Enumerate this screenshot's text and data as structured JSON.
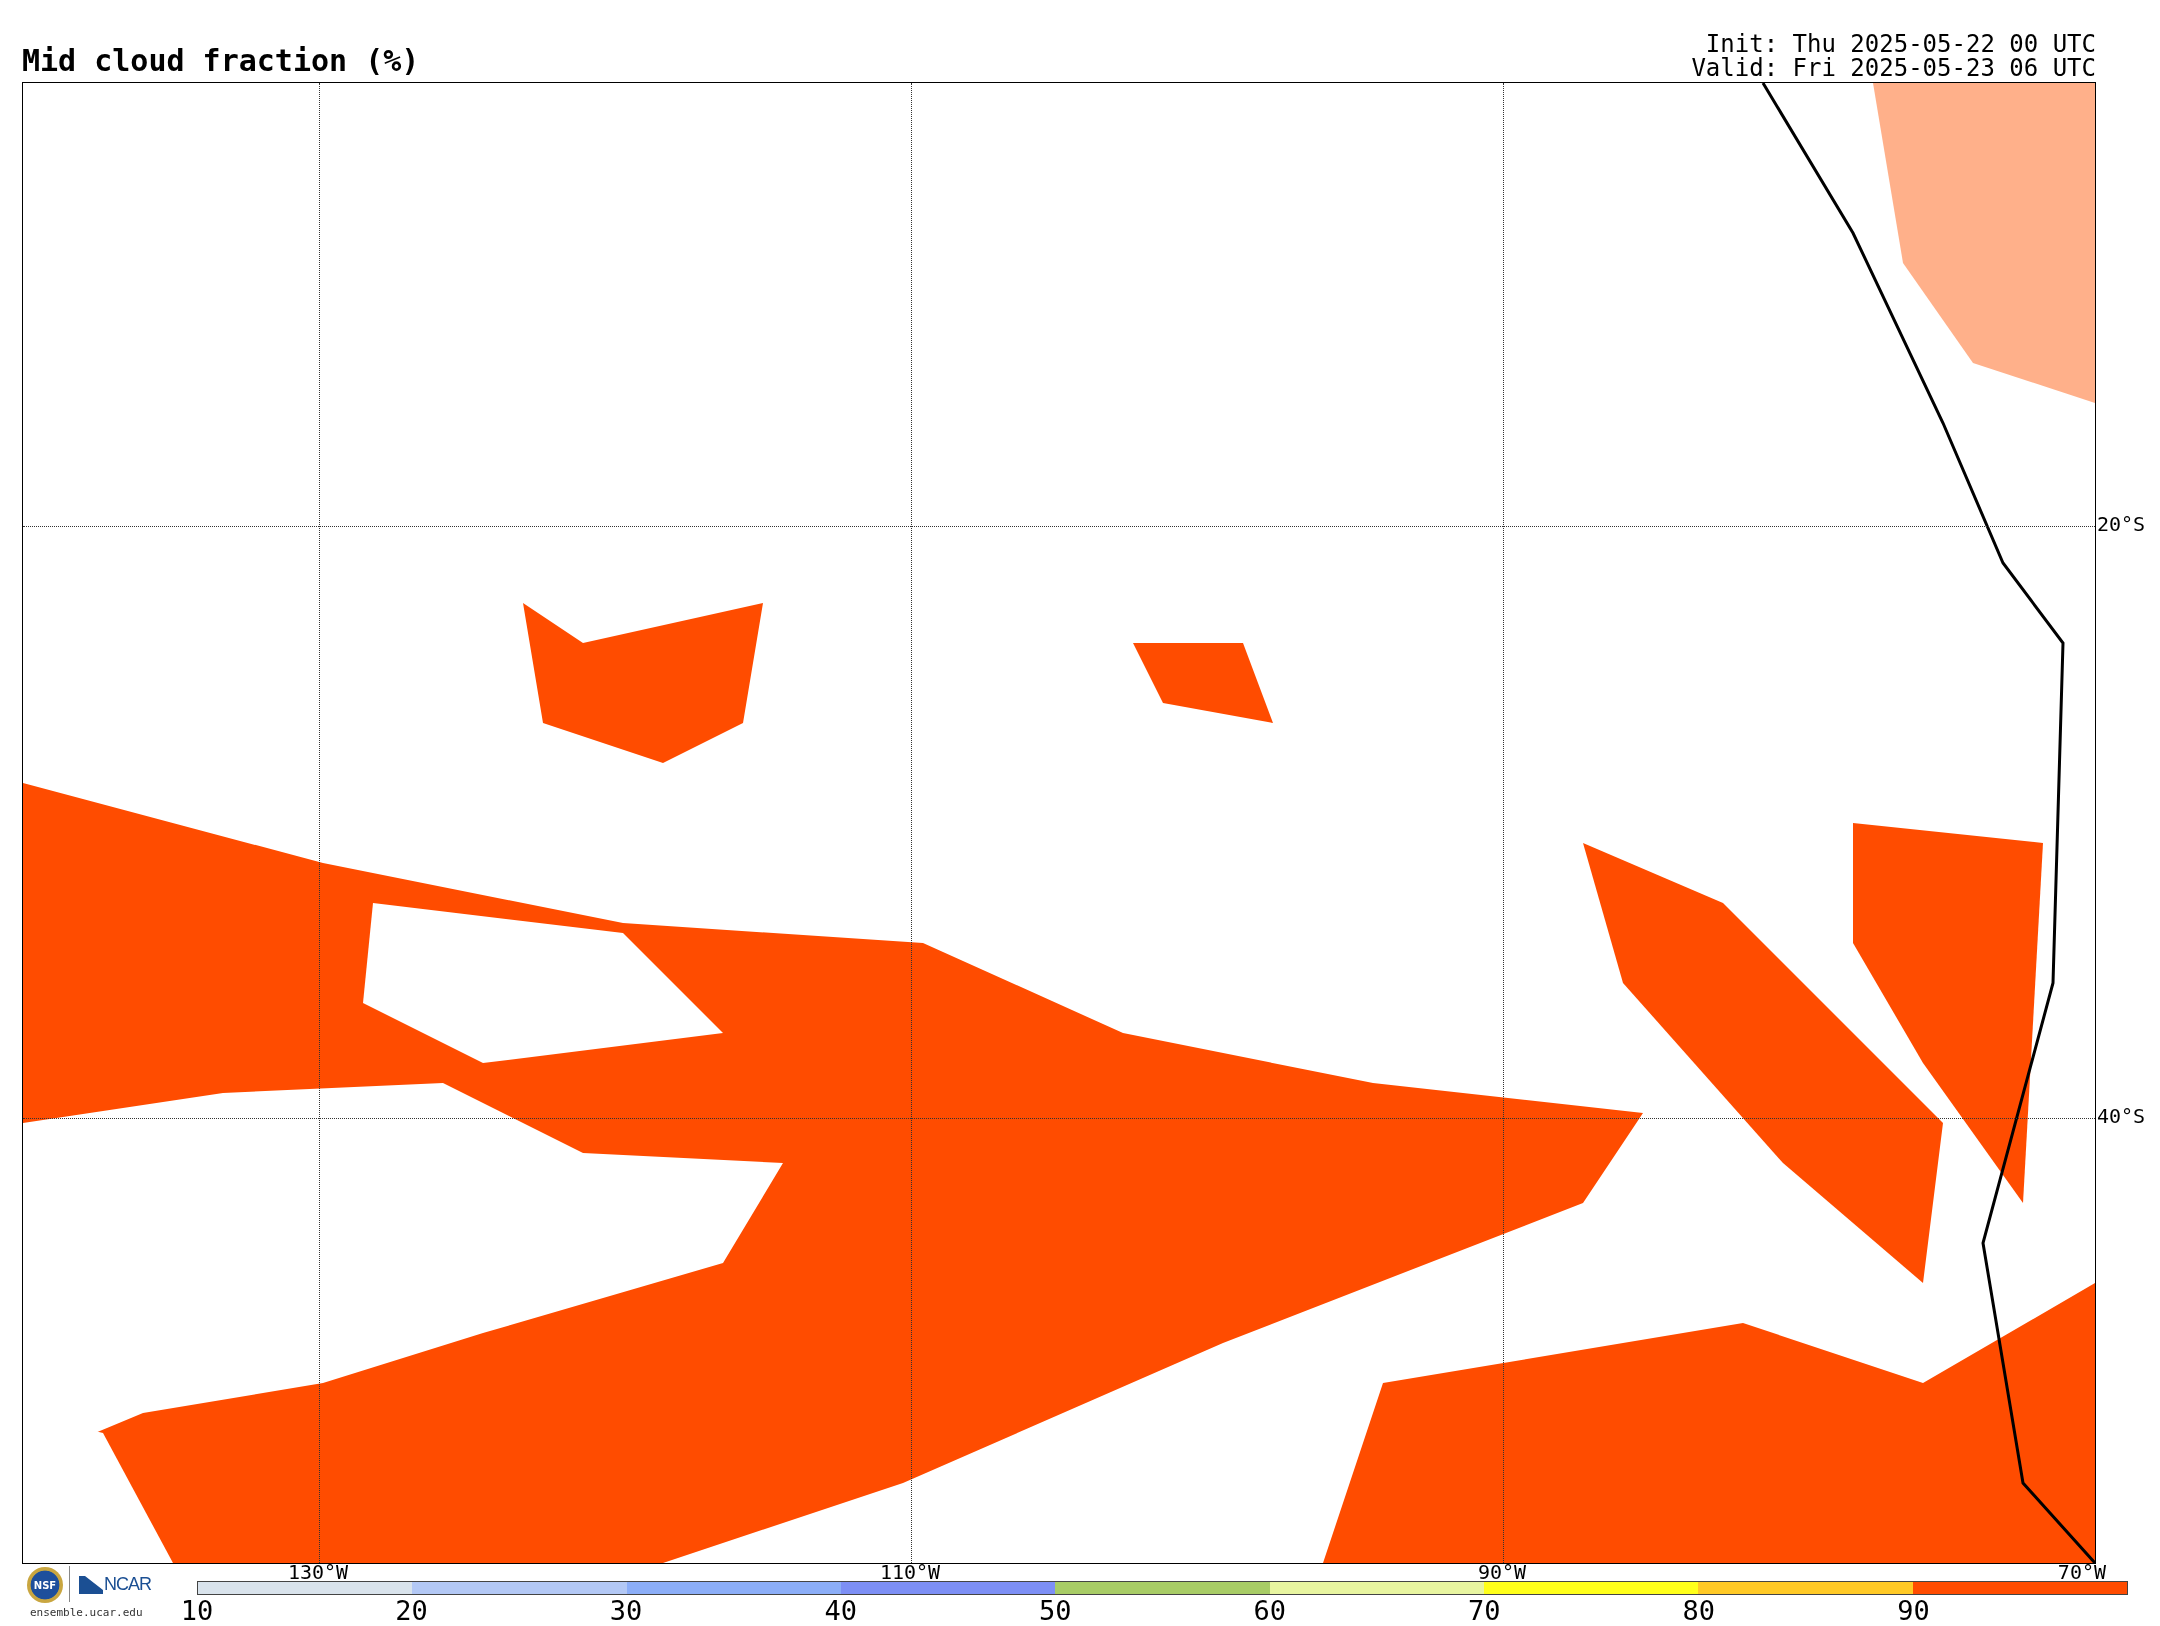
{
  "header": {
    "title": "Mid cloud fraction (%)",
    "init": "Init: Thu 2025-05-22 00 UTC",
    "valid": "Valid: Fri 2025-05-23 06 UTC"
  },
  "map": {
    "lat_labels": [
      "20°S",
      "40°S"
    ],
    "lon_labels": [
      "130°W",
      "110°W",
      "90°W",
      "70°W"
    ]
  },
  "logos": {
    "seal": "NSF",
    "org": "NCAR",
    "site": "ensemble.ucar.edu"
  },
  "colorbar": {
    "segments": [
      {
        "color": "#d9e3ec"
      },
      {
        "color": "#b3c8f5"
      },
      {
        "color": "#8caef8"
      },
      {
        "color": "#7d8ff5"
      },
      {
        "color": "#a8cc66"
      },
      {
        "color": "#e8f5a0"
      },
      {
        "color": "#ffff1a"
      },
      {
        "color": "#ffc926"
      },
      {
        "color": "#ff4c00"
      }
    ],
    "ticks": [
      "10",
      "20",
      "30",
      "40",
      "50",
      "60",
      "70",
      "80",
      "90"
    ]
  }
}
